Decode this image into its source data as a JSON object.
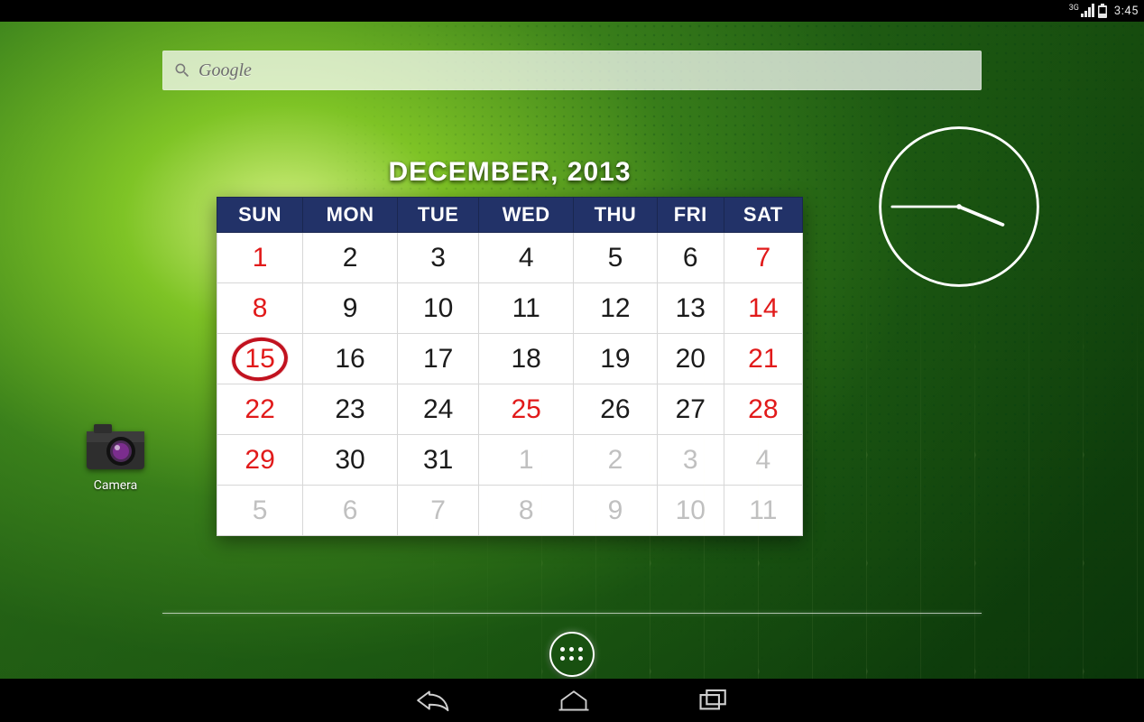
{
  "status_bar": {
    "network_label": "3G",
    "clock": "3:45"
  },
  "search": {
    "placeholder": "Google"
  },
  "apps": {
    "camera": {
      "label": "Camera"
    }
  },
  "calendar": {
    "title": "DECEMBER, 2013",
    "day_headers": [
      "SUN",
      "MON",
      "TUE",
      "WED",
      "THU",
      "FRI",
      "SAT"
    ],
    "weeks": [
      [
        {
          "n": "1",
          "weekend": true
        },
        {
          "n": "2"
        },
        {
          "n": "3"
        },
        {
          "n": "4"
        },
        {
          "n": "5"
        },
        {
          "n": "6"
        },
        {
          "n": "7",
          "weekend": true
        }
      ],
      [
        {
          "n": "8",
          "weekend": true
        },
        {
          "n": "9"
        },
        {
          "n": "10"
        },
        {
          "n": "11"
        },
        {
          "n": "12"
        },
        {
          "n": "13"
        },
        {
          "n": "14",
          "weekend": true
        }
      ],
      [
        {
          "n": "15",
          "weekend": true,
          "today": true
        },
        {
          "n": "16"
        },
        {
          "n": "17"
        },
        {
          "n": "18"
        },
        {
          "n": "19"
        },
        {
          "n": "20"
        },
        {
          "n": "21",
          "weekend": true
        }
      ],
      [
        {
          "n": "22",
          "weekend": true
        },
        {
          "n": "23"
        },
        {
          "n": "24"
        },
        {
          "n": "25",
          "weekend": true
        },
        {
          "n": "26"
        },
        {
          "n": "27"
        },
        {
          "n": "28",
          "weekend": true
        }
      ],
      [
        {
          "n": "29",
          "weekend": true
        },
        {
          "n": "30"
        },
        {
          "n": "31"
        },
        {
          "n": "1",
          "other": true
        },
        {
          "n": "2",
          "other": true
        },
        {
          "n": "3",
          "other": true
        },
        {
          "n": "4",
          "other": true
        }
      ],
      [
        {
          "n": "5",
          "other": true
        },
        {
          "n": "6",
          "other": true
        },
        {
          "n": "7",
          "other": true
        },
        {
          "n": "8",
          "other": true
        },
        {
          "n": "9",
          "other": true
        },
        {
          "n": "10",
          "other": true
        },
        {
          "n": "11",
          "other": true
        }
      ]
    ]
  },
  "clock_widget": {
    "hour": 3,
    "minute": 45
  },
  "colors": {
    "calendar_header_bg": "#223268",
    "weekend_color": "#e11a1a",
    "today_ring": "#c1121f"
  }
}
